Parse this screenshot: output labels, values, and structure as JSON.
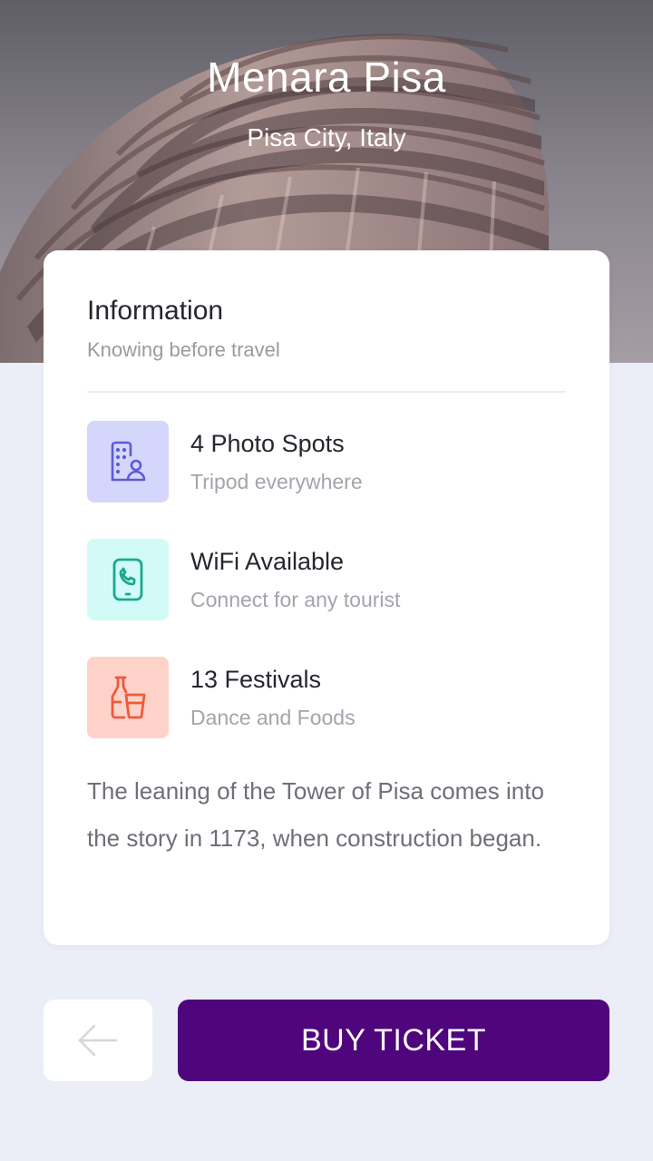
{
  "hero": {
    "title": "Menara Pisa",
    "subtitle": "Pisa City, Italy"
  },
  "info": {
    "title": "Information",
    "subtitle": "Knowing before travel",
    "features": [
      {
        "title": "4 Photo Spots",
        "description": "Tripod everywhere",
        "icon": "building-user-icon",
        "icon_color": "#5b5bd6",
        "bg_color": "#d5d6fb"
      },
      {
        "title": "WiFi Available",
        "description": "Connect for any tourist",
        "icon": "phone-call-icon",
        "icon_color": "#1aa88c",
        "bg_color": "#d2fbf7"
      },
      {
        "title": "13 Festivals",
        "description": "Dance and Foods",
        "icon": "bottle-cup-icon",
        "icon_color": "#ee5a3c",
        "bg_color": "#fdd3c9"
      }
    ],
    "description": "The leaning of the Tower of Pisa comes into the story in 1173, when construction began."
  },
  "actions": {
    "back_icon": "arrow-left-icon",
    "buy_label": "BUY TICKET",
    "buy_color": "#4f067c"
  }
}
